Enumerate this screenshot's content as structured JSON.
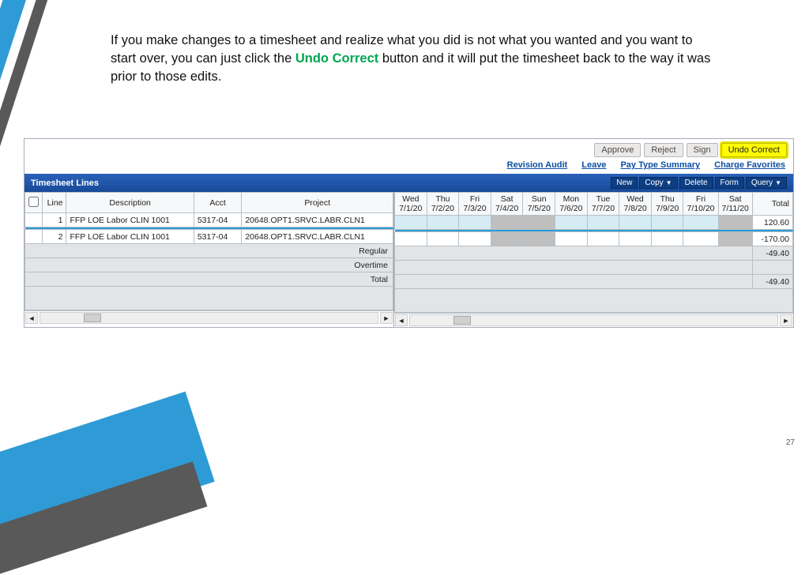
{
  "slide": {
    "text_before": "If you make changes to a timesheet and realize what you did is not what you wanted and you want to start over, you can just click the ",
    "text_green": "Undo Correct",
    "text_after": " button and it will put the timesheet back to the way it was prior to those edits.",
    "page_number": "27"
  },
  "top_buttons": {
    "approve": "Approve",
    "reject": "Reject",
    "sign": "Sign",
    "undo_correct": "Undo Correct"
  },
  "links": {
    "revision_audit": "Revision Audit",
    "leave": "Leave",
    "pay_type_summary": "Pay Type Summary",
    "charge_favorites": "Charge Favorites"
  },
  "section": {
    "title": "Timesheet Lines",
    "mini": {
      "new": "New",
      "copy": "Copy",
      "delete": "Delete",
      "form": "Form",
      "query": "Query"
    }
  },
  "columns": {
    "line": "Line",
    "description": "Description",
    "acct": "Acct",
    "project": "Project",
    "total": "Total",
    "days": [
      {
        "dow": "Wed",
        "date": "7/1/20"
      },
      {
        "dow": "Thu",
        "date": "7/2/20"
      },
      {
        "dow": "Fri",
        "date": "7/3/20"
      },
      {
        "dow": "Sat",
        "date": "7/4/20"
      },
      {
        "dow": "Sun",
        "date": "7/5/20"
      },
      {
        "dow": "Mon",
        "date": "7/6/20"
      },
      {
        "dow": "Tue",
        "date": "7/7/20"
      },
      {
        "dow": "Wed",
        "date": "7/8/20"
      },
      {
        "dow": "Thu",
        "date": "7/9/20"
      },
      {
        "dow": "Fri",
        "date": "7/10/20"
      },
      {
        "dow": "Sat",
        "date": "7/11/20"
      }
    ]
  },
  "rows": [
    {
      "line": "1",
      "description": "FFP LOE Labor CLIN 1001",
      "acct": "5317-04",
      "project": "20648.OPT1.SRVC.LABR.CLN1",
      "total": "120.60"
    },
    {
      "line": "2",
      "description": "FFP LOE Labor CLIN 1001",
      "acct": "5317-04",
      "project": "20648.OPT1.SRVC.LABR.CLN1",
      "total": "-170.00"
    }
  ],
  "summary": {
    "regular": {
      "label": "Regular",
      "total": "-49.40"
    },
    "overtime": {
      "label": "Overtime",
      "total": ""
    },
    "total": {
      "label": "Total",
      "total": "-49.40"
    }
  }
}
